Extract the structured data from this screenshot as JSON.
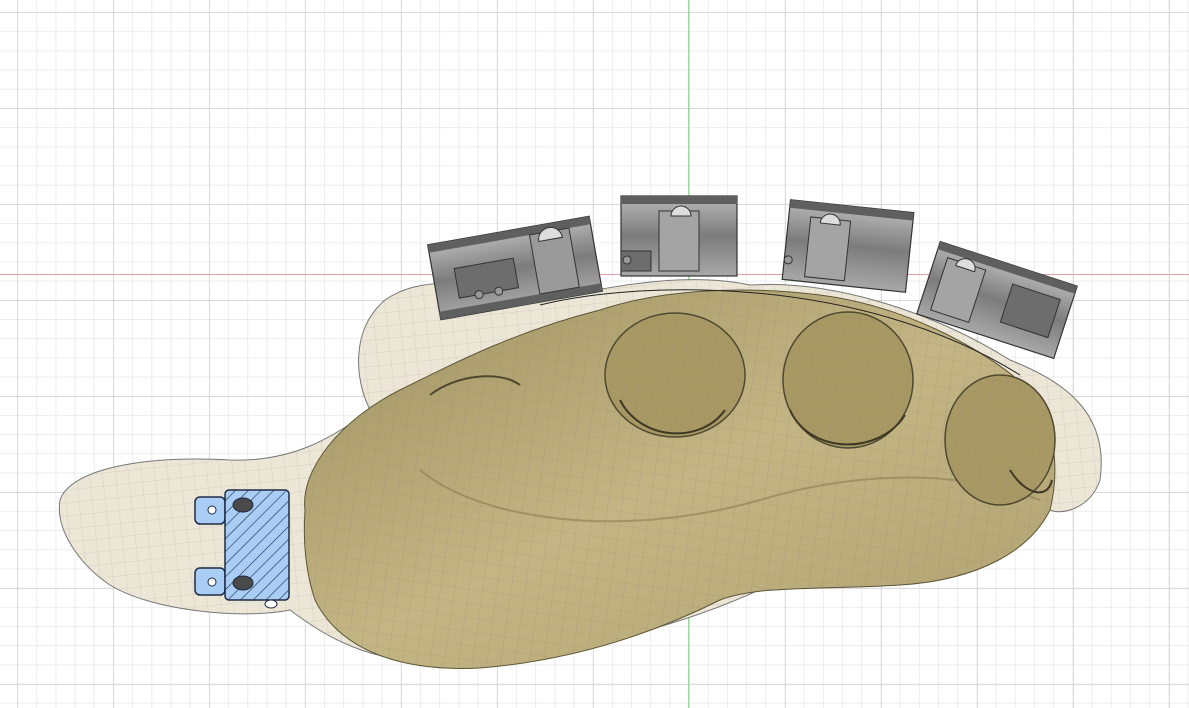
{
  "viewport": {
    "background": "#ffffff",
    "grid_color": "#d2d2d2",
    "axis_x_color": "#e0a0a0",
    "axis_y_color": "#9ed89e"
  },
  "model": {
    "shell_color": "#e9e3d3",
    "cavity_color": "#b7a774",
    "component_color": "#8e8e8e",
    "section_hatch_color": "#a9cdf5",
    "component_count": 4
  },
  "icons": {
    "origin": "axis-origin-icon",
    "grid": "construction-grid-icon"
  }
}
